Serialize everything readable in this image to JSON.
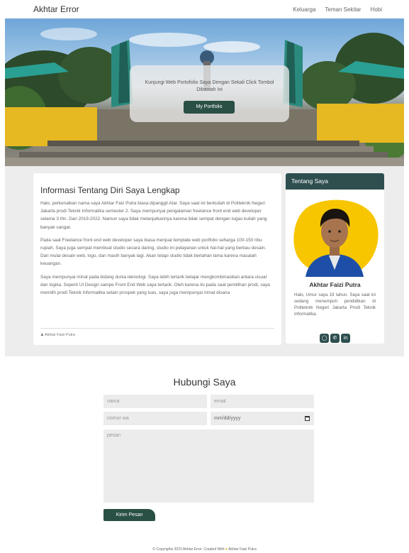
{
  "navbar": {
    "brand": "Akhtar Error",
    "links": [
      "Keluarga",
      "Teman Sekitar",
      "Hobi"
    ]
  },
  "hero": {
    "text": "Kunjungi Web Portofolio Saya Dengan Sekali Click Tombol Dibawah Ini",
    "button": "My Portfolio"
  },
  "about": {
    "title": "Informasi Tentang Diri Saya Lengkap",
    "paragraphs": [
      "Halo, perkenalkan nama saya Akhtar Faiz Putra biasa dipanggil Atar. Saya saat ini berkuliah di Politeknik Negeri Jakarta prodi Teknik Informatika semester 2. Saya mempunyai pengalaman freelance front end web developer selama 3 thn. Dari 2019-2022. Namun saya tidak melanjutkannya karena tidak sempat dengan tugas kuliah yang banyak sangat.",
      "Pada saat Freelance front end web developer saya biasa menjual template web portfolio seharga 100-150 ribu rupiah. Saya juga sempat membuat studio secara daring, studio ini pelayanan untuk hal-hal yang berbau desain. Dari mulai desain web, logo, dan masih banyak lagi. Akan tetapi studio tidak bertahan lama karena masalah keuangan.",
      "Saya mempunyai minat pada bidang dunia teknologi. Saya lebih tertarik belajar mengkombinasikan antara visual dan logika. Seperti UI Design sampe Front End Web saya tertarik. Oleh karena itu pada saat pemilihan prodi, saya memilih prodi Teknik Informatika selain prospek yang luas, saya juga mempunyai minat disana"
    ],
    "author": "Akhtar Faizi Putra"
  },
  "profile": {
    "header": "Tentang Saya",
    "name": "Akhtar Faizi Putra",
    "description": "Halo, Umur saya 19 tahun. Saya saat ini sedang menempuh pendidikan di Politeknik Negeri Jakarta Prodi Teknik Informatika.",
    "socials": [
      "instagram-icon",
      "whatsapp-icon",
      "linkedin-icon"
    ]
  },
  "contact": {
    "title": "Hubungi Saya",
    "name_placeholder": "nama",
    "email_placeholder": "email",
    "phone_placeholder": "nomor wa",
    "date_placeholder": "mm/dd/yyyy",
    "message_placeholder": "pesan",
    "submit": "Kirim Pesan"
  },
  "footer": {
    "prefix": "© Copyrights 2023 Akhtar Error. Created With",
    "suffix": "Akhtar Faizi Putra"
  },
  "colors": {
    "accent": "#2f4f4f",
    "button": "#2a4f45",
    "profile_blob": "#f7c600"
  }
}
